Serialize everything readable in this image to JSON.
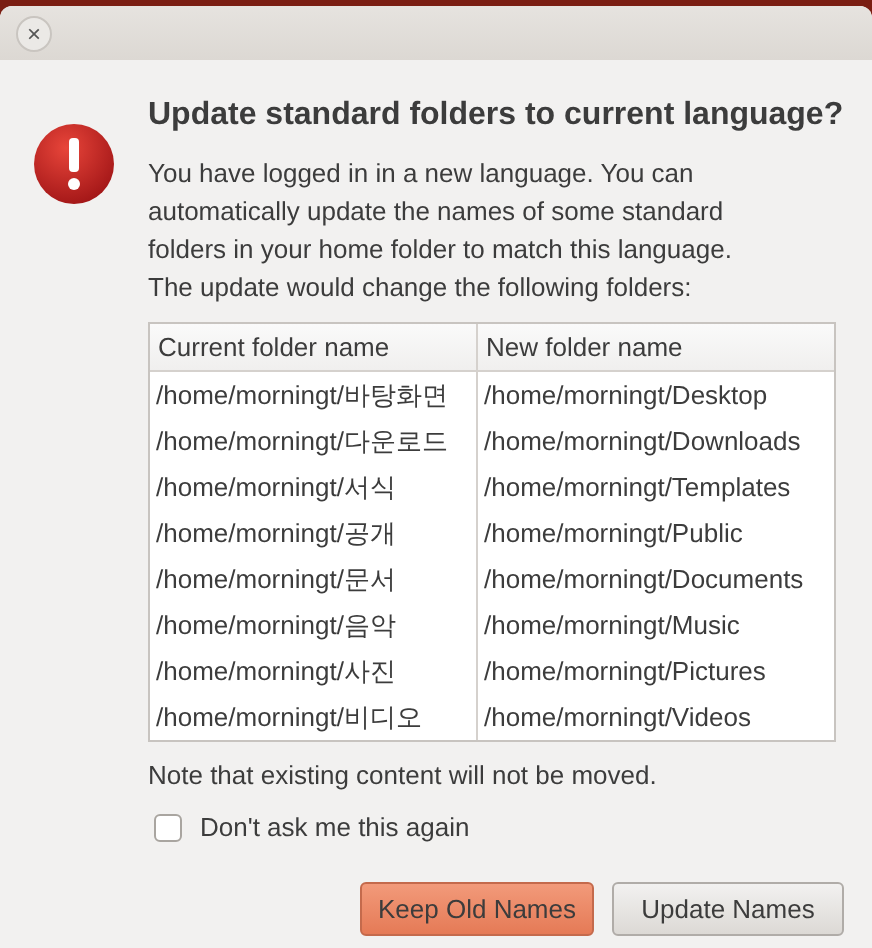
{
  "window": {
    "close": "×"
  },
  "title": "Update standard folders to current language?",
  "message": "You have logged in in a new language. You can automatically update the names of some standard folders in your home folder to match this language. The update would change the following folders:",
  "table": {
    "columns": [
      "Current folder name",
      "New folder name"
    ],
    "rows": [
      [
        "/home/morningt/바탕화면",
        "/home/morningt/Desktop"
      ],
      [
        "/home/morningt/다운로드",
        "/home/morningt/Downloads"
      ],
      [
        "/home/morningt/서식",
        "/home/morningt/Templates"
      ],
      [
        "/home/morningt/공개",
        "/home/morningt/Public"
      ],
      [
        "/home/morningt/문서",
        "/home/morningt/Documents"
      ],
      [
        "/home/morningt/음악",
        "/home/morningt/Music"
      ],
      [
        "/home/morningt/사진",
        "/home/morningt/Pictures"
      ],
      [
        "/home/morningt/비디오",
        "/home/morningt/Videos"
      ]
    ]
  },
  "note": "Note that existing content will not be moved.",
  "checkbox": {
    "label": "Don't ask me this again",
    "checked": false
  },
  "buttons": [
    {
      "label": "Keep Old Names",
      "kind": "default"
    },
    {
      "label": "Update Names",
      "kind": "normal"
    }
  ]
}
